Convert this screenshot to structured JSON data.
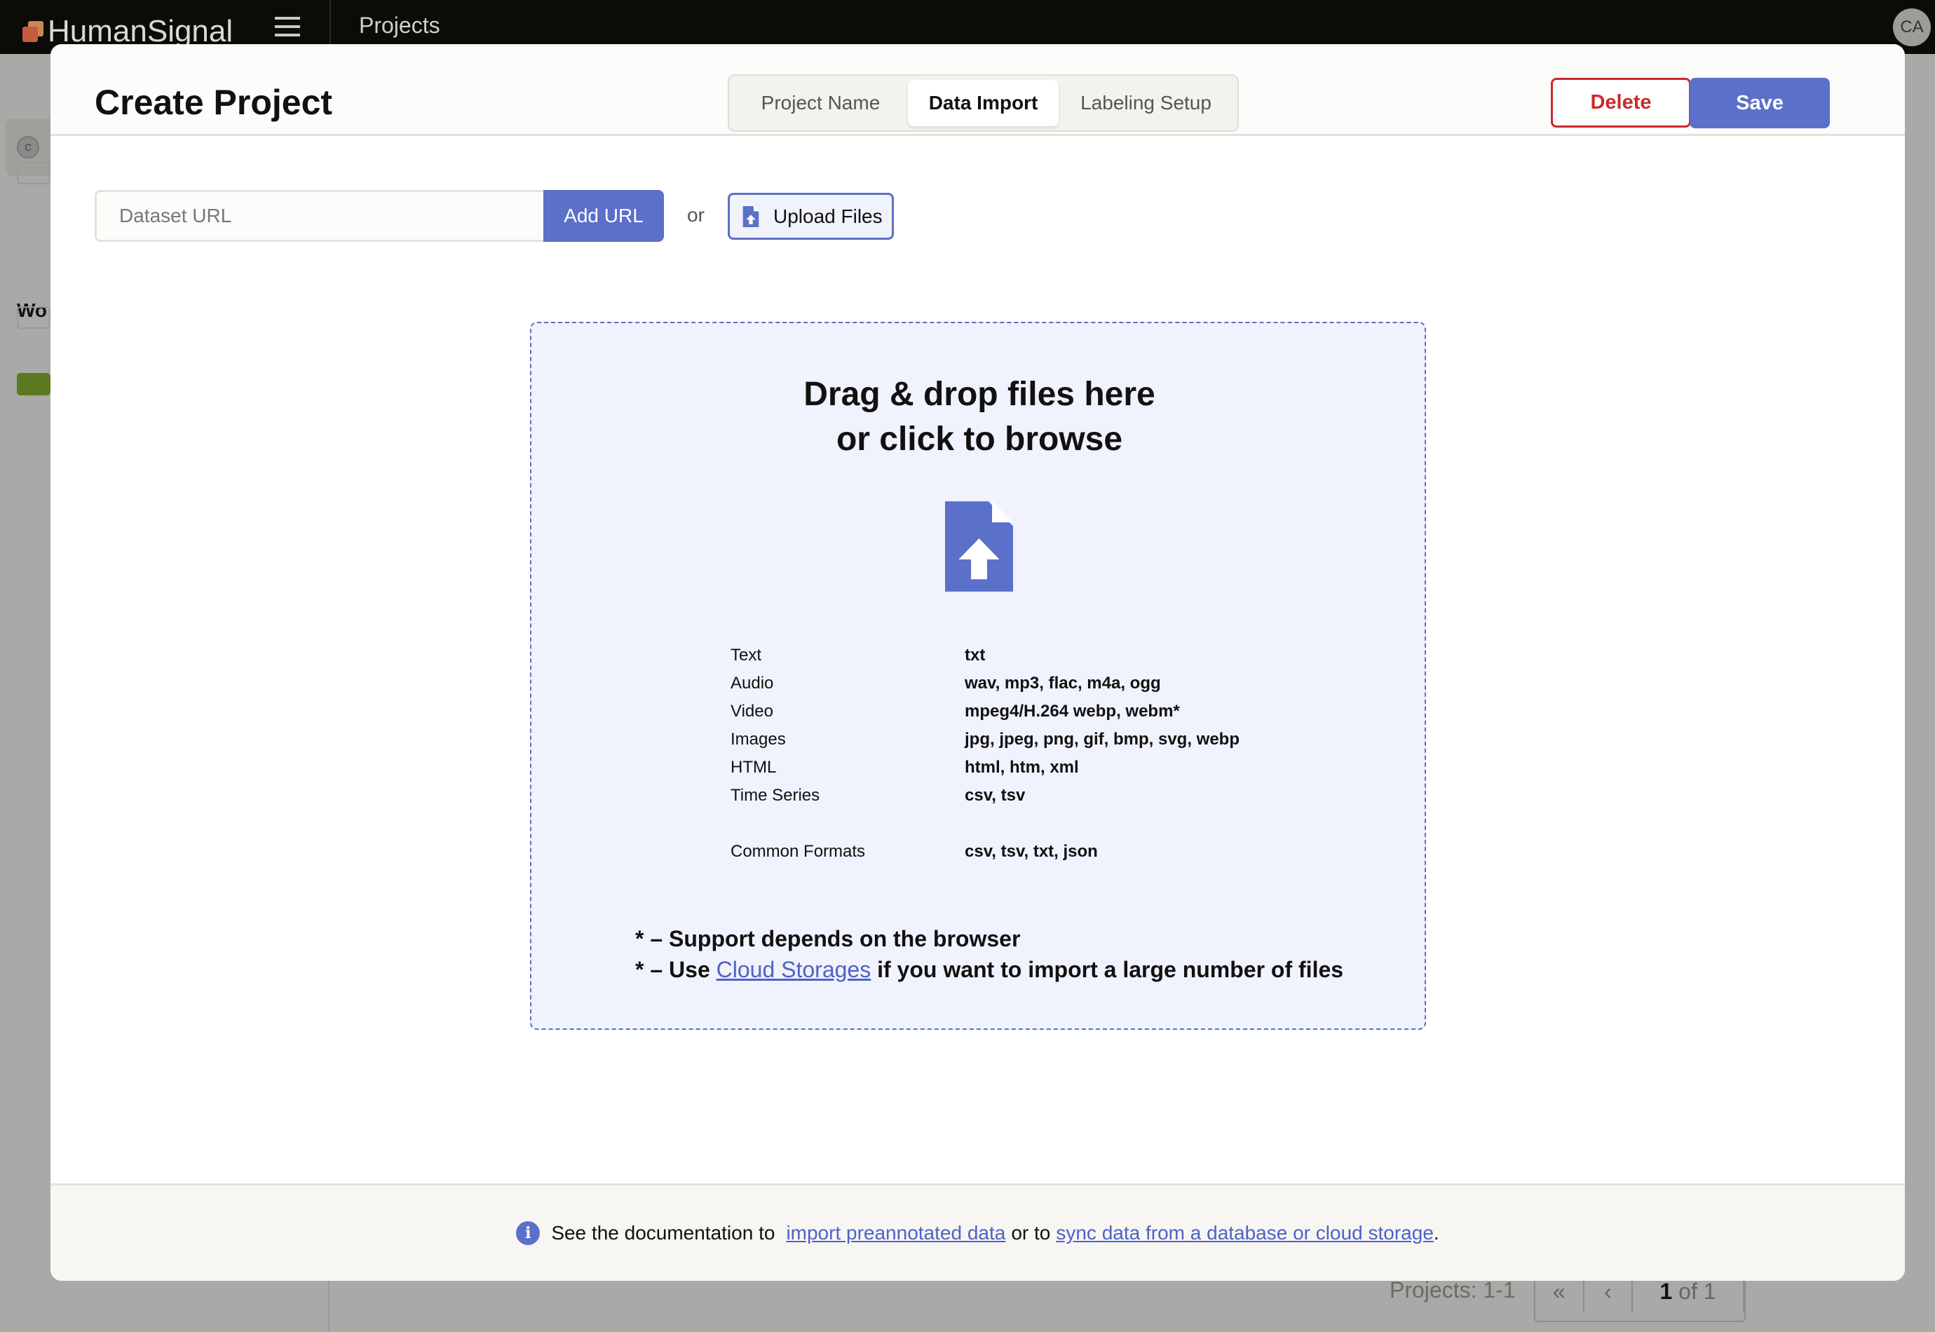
{
  "app": {
    "brand": "HumanSignal",
    "breadcrumb": "Projects",
    "user_initials": "CA"
  },
  "background": {
    "workspace_initial": "C",
    "workspaces_heading_partial": "Wo",
    "projects_count": "Projects: 1-1",
    "page_current": "1",
    "page_of": "of 1"
  },
  "modal": {
    "title": "Create Project",
    "tabs": [
      {
        "label": "Project Name"
      },
      {
        "label": "Data Import",
        "active": true
      },
      {
        "label": "Labeling Setup"
      }
    ],
    "delete_label": "Delete",
    "save_label": "Save",
    "url_placeholder": "Dataset URL",
    "url_value": "",
    "add_url_label": "Add URL",
    "or_label": "or",
    "upload_label": "Upload Files",
    "drop_line1": "Drag & drop files here",
    "drop_line2": "or click to browse",
    "formats": [
      {
        "type": "Text",
        "ext": "txt"
      },
      {
        "type": "Audio",
        "ext": "wav, mp3, flac, m4a, ogg"
      },
      {
        "type": "Video",
        "ext": "mpeg4/H.264 webp, webm*"
      },
      {
        "type": "Images",
        "ext": "jpg, jpeg, png, gif, bmp, svg, webp"
      },
      {
        "type": "HTML",
        "ext": "html, htm, xml"
      },
      {
        "type": "Time Series",
        "ext": "csv, tsv"
      },
      {
        "type": "Common Formats",
        "ext": "csv, tsv, txt, json"
      }
    ],
    "note1": "* – Support depends on the browser",
    "note2_prefix": "* – Use ",
    "note2_link": "Cloud Storages",
    "note2_suffix": " if you want to import a large number of files",
    "footer": {
      "prefix": "See the documentation to",
      "link1": "import preannotated data",
      "mid": "or to",
      "link2": "sync data from a database or cloud storage",
      "suffix": "."
    }
  },
  "colors": {
    "accent": "#5b70c8",
    "danger": "#cc2a2a",
    "topbar": "#0c0b08"
  }
}
